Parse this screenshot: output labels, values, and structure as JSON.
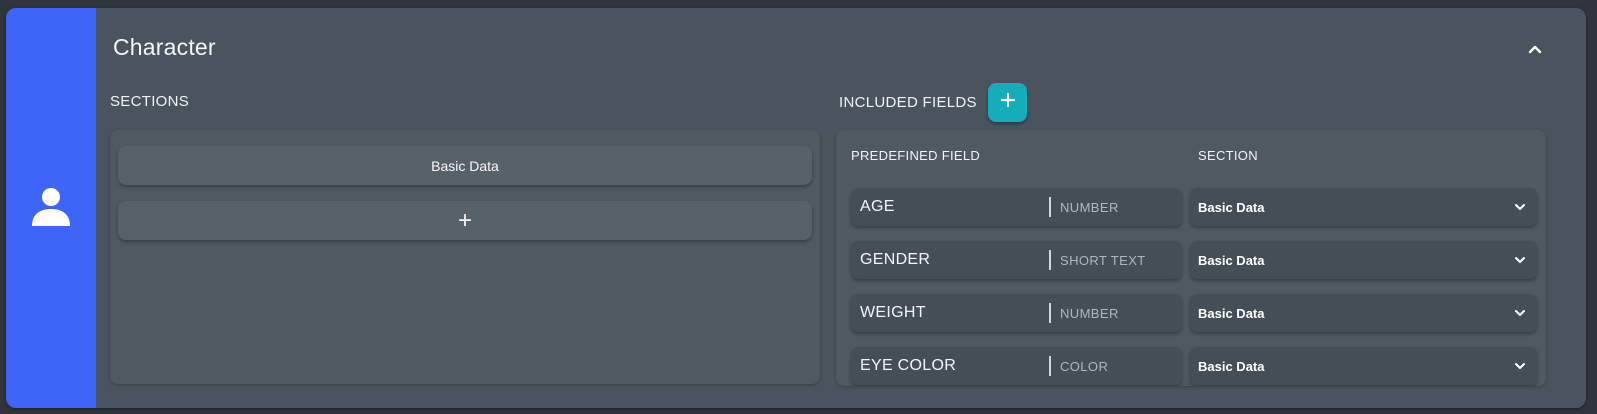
{
  "card": {
    "title": "Character",
    "icon": "user-icon",
    "accent_color": "#3d66f8"
  },
  "sections": {
    "label": "SECTIONS",
    "items": [
      {
        "label": "Basic Data"
      },
      {
        "label": "+"
      }
    ]
  },
  "included_fields": {
    "label": "INCLUDED FIELDS",
    "add_button_label": "+",
    "add_button_color": "#14adb8",
    "columns": {
      "field": "PREDEFINED FIELD",
      "section": "SECTION"
    },
    "rows": [
      {
        "name": "AGE",
        "type": "NUMBER",
        "section": "Basic Data"
      },
      {
        "name": "GENDER",
        "type": "SHORT TEXT",
        "section": "Basic Data"
      },
      {
        "name": "WEIGHT",
        "type": "NUMBER",
        "section": "Basic Data"
      },
      {
        "name": "EYE COLOR",
        "type": "COLOR",
        "section": "Basic Data"
      }
    ]
  }
}
